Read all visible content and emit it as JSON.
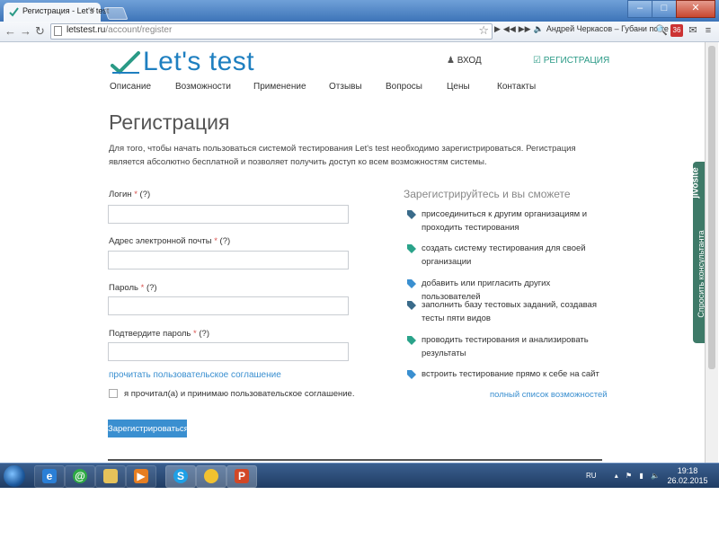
{
  "browser": {
    "tab_title": "Регистрация - Let's test",
    "tab_close": "×",
    "url_host": "letstest.ru",
    "url_path": "/account/register",
    "extension_text": "Андрей Черкасов – Губани по те",
    "extension_badge": "36"
  },
  "header": {
    "logo_text": "Let's test",
    "login_label": "ВХОД",
    "register_label": "РЕГИСТРАЦИЯ"
  },
  "menu": [
    {
      "label": "Описание"
    },
    {
      "label": "Возможности"
    },
    {
      "label": "Применение"
    },
    {
      "label": "Отзывы"
    },
    {
      "label": "Вопросы"
    },
    {
      "label": "Цены"
    },
    {
      "label": "Контакты"
    }
  ],
  "main": {
    "title": "Регистрация",
    "intro": "Для того, чтобы начать пользоваться системой тестирования Let's test необходимо зарегистрироваться. Регистрация является абсолютно бесплатной и позволяет получить доступ ко всем возможностям системы."
  },
  "form": {
    "login_label": "Логин",
    "email_label": "Адрес электронной почты",
    "password_label": "Пароль",
    "confirm_label": "Подтвердите пароль",
    "required_mark": "*",
    "help_mark": "(?)",
    "login_value": "",
    "email_value": "",
    "password_value": "",
    "confirm_value": "",
    "agreement_link": "прочитать пользовательское соглашение",
    "agree_checkbox_label": "я прочитал(а) и принимаю пользовательское соглашение.",
    "submit_label": "Зарегистрироваться"
  },
  "sidebar": {
    "title": "Зарегистрируйтесь и вы сможете",
    "features": [
      {
        "text": "присоединиться к другим организациям и проходить тестирования",
        "color": "#3a6b8a"
      },
      {
        "text": "создать систему тестирования для своей организации",
        "color": "#2aa38a"
      },
      {
        "text": "добавить или пригласить других пользователей",
        "color": "#3a8fd0"
      },
      {
        "text": "заполнить базу тестовых заданий, создавая тесты пяти видов",
        "color": "#3a6b8a"
      },
      {
        "text": "проводить тестирования и анализировать результаты",
        "color": "#2aa38a"
      },
      {
        "text": "встроить тестирование прямо к себе на сайт",
        "color": "#3a8fd0"
      }
    ],
    "all_features_link": "полный список возможностей"
  },
  "jivosite": {
    "logo": "jivosite",
    "label": "Спросить консультанта"
  },
  "taskbar": {
    "language": "RU",
    "time": "19:18",
    "date": "26.02.2015"
  },
  "colors": {
    "brand_blue": "#1e7fc0",
    "brand_green": "#2a9a86",
    "link_blue": "#3a8fd0",
    "required_red": "#d9534f"
  }
}
